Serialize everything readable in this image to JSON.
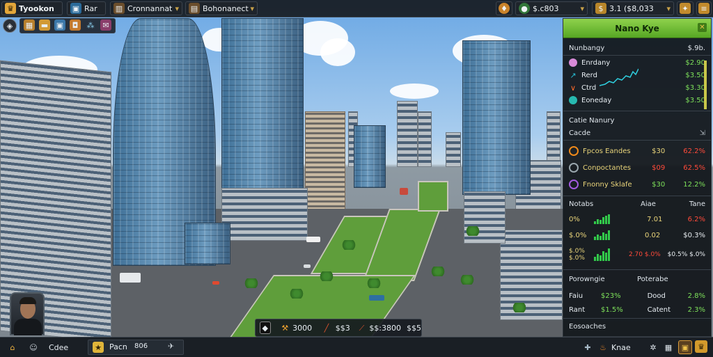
{
  "top": {
    "brand": "Tyookon",
    "tab1": "Rar",
    "tab2": "Cronnannat",
    "tab3": "Bohonanect",
    "money1": "$.c803",
    "money2": "3.1 ($8,033",
    "icons": [
      "shield-icon",
      "crate-icon",
      "folder-icon",
      "map-icon",
      "network-icon",
      "bag-icon"
    ]
  },
  "panel": {
    "title": "Nano Kye",
    "header": {
      "label": "Nunbangy",
      "value": "$.9b."
    },
    "rows": [
      {
        "label": "Enrdany",
        "value": "$2.90"
      },
      {
        "label": "Rerd",
        "value": "$3.50"
      },
      {
        "label": "Ctrd",
        "value": "$3.30"
      },
      {
        "label": "Eoneday",
        "value": "$3.50"
      }
    ],
    "section2": {
      "title": "Catie Nanury",
      "sub": "Cacde"
    },
    "props": [
      {
        "name": "Fpcos Eandes",
        "value": "$30",
        "change": "62.2%",
        "color": "#e04a2a"
      },
      {
        "name": "Conpoctantes",
        "value": "$09",
        "change": "62.5%",
        "color": "#e04a2a"
      },
      {
        "name": "Fnonny Sklafe",
        "value": "$30",
        "change": "12.2%",
        "color": "#3fd45a"
      }
    ],
    "section3": {
      "c1": "Notabs",
      "c2": "Aiae",
      "c3": "Tane"
    },
    "stats": [
      {
        "a": "0%",
        "b": "7.01",
        "c": "6.2%"
      },
      {
        "a": "$.0%",
        "b": "0.02",
        "c": "$0.3%"
      },
      {
        "a": "$.0% $.0%",
        "b": "2.70 $.0%",
        "c": "$0.5% $.0%"
      }
    ],
    "section4": {
      "c1": "Porowngie",
      "c2": "Poterabe"
    },
    "rev": [
      {
        "a": "Faiu",
        "b": "$23%",
        "c": "Dood",
        "d": "2.8%"
      },
      {
        "a": "Rant",
        "b": "$1.5%",
        "c": "Catent",
        "d": "2.3%"
      }
    ],
    "footer": "Eosoaches"
  },
  "hudbottom": {
    "cash": "3000",
    "v1": "$$3",
    "v2": "$$:3800",
    "v3": "$$5"
  },
  "bottom": {
    "tab1": "Cdee",
    "tab2": "Pacn",
    "tab2b": "806",
    "right": "Knae"
  }
}
